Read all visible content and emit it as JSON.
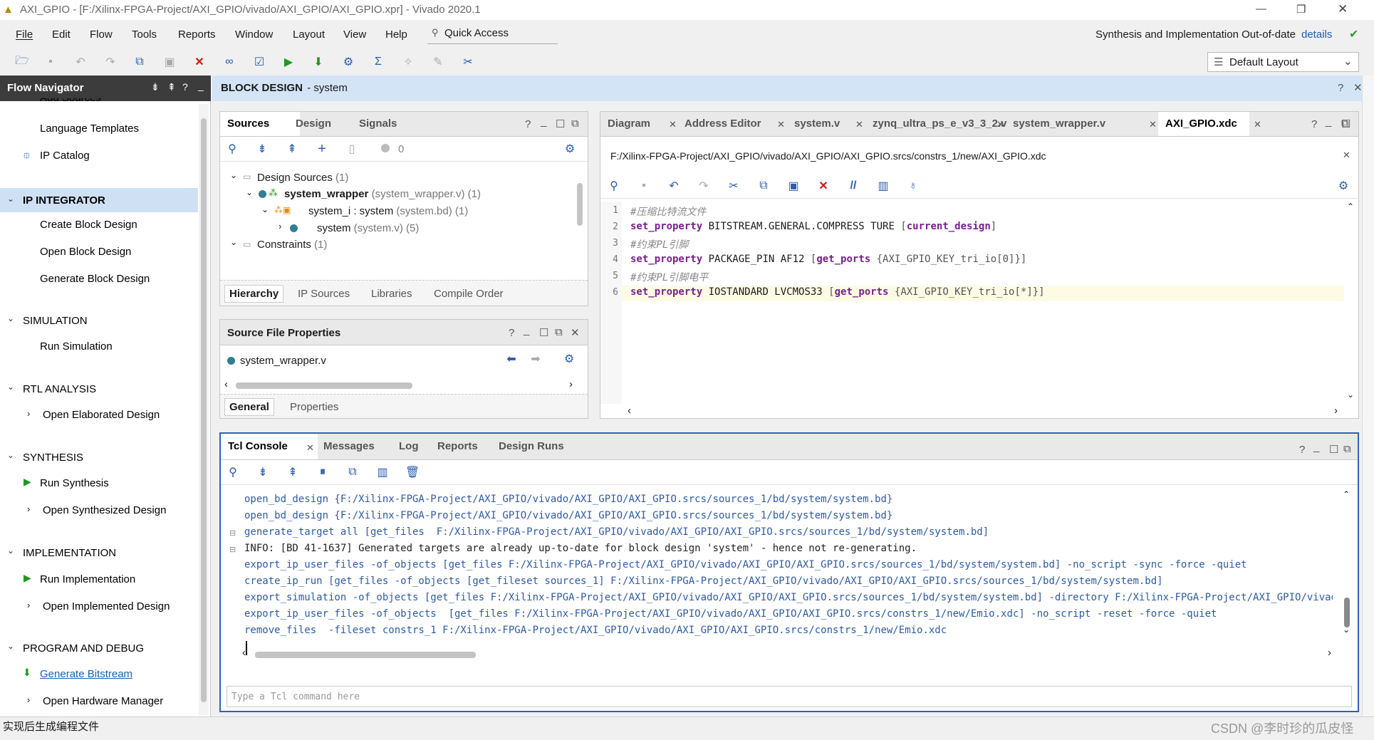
{
  "window": {
    "title": "AXI_GPIO - [F:/Xilinx-FPGA-Project/AXI_GPIO/vivado/AXI_GPIO/AXI_GPIO.xpr] - Vivado 2020.1",
    "controls": [
      "—",
      "❐",
      "✕"
    ]
  },
  "menu": {
    "items": [
      "File",
      "Edit",
      "Flow",
      "Tools",
      "Reports",
      "Window",
      "Layout",
      "View",
      "Help"
    ],
    "quick_access": "Quick Access",
    "status_text": "Synthesis and Implementation Out-of-date",
    "status_link": "details"
  },
  "toolbar": {
    "layout_select": "Default Layout"
  },
  "flow_navigator": {
    "title": "Flow Navigator",
    "partial_top": "Add Sources",
    "language_templates": "Language Templates",
    "ip_catalog": "IP Catalog",
    "sections": [
      {
        "label": "IP INTEGRATOR",
        "items": [
          "Create Block Design",
          "Open Block Design",
          "Generate Block Design"
        ]
      },
      {
        "label": "SIMULATION",
        "items": [
          "Run Simulation"
        ]
      },
      {
        "label": "RTL ANALYSIS",
        "items": [
          "Open Elaborated Design"
        ]
      },
      {
        "label": "SYNTHESIS",
        "items": [
          "Run Synthesis",
          "Open Synthesized Design"
        ]
      },
      {
        "label": "IMPLEMENTATION",
        "items": [
          "Run Implementation",
          "Open Implemented Design"
        ]
      },
      {
        "label": "PROGRAM AND DEBUG",
        "items": [
          "Generate Bitstream",
          "Open Hardware Manager"
        ]
      }
    ]
  },
  "block_design": {
    "title_bold": "BLOCK DESIGN",
    "title_rest": " - system"
  },
  "sources": {
    "tabs": [
      "Sources",
      "Design",
      "Signals"
    ],
    "count_badge": "0",
    "tree": [
      {
        "label": "Design Sources",
        "suffix": " (1)"
      },
      {
        "label": "system_wrapper",
        "suffix": " (system_wrapper.v) (1)"
      },
      {
        "label": "system_i : system",
        "suffix": " (system.bd) (1)"
      },
      {
        "label": "system",
        "suffix": " (system.v) (5)"
      },
      {
        "label": "Constraints",
        "suffix": " (1)"
      }
    ],
    "bottom_tabs": [
      "Hierarchy",
      "IP Sources",
      "Libraries",
      "Compile Order"
    ]
  },
  "source_props": {
    "title": "Source File Properties",
    "file": "system_wrapper.v",
    "tabs": [
      "General",
      "Properties"
    ]
  },
  "editor": {
    "tabs": [
      "Diagram",
      "Address Editor",
      "system.v",
      "zynq_ultra_ps_e_v3_3_2.v",
      "system_wrapper.v",
      "AXI_GPIO.xdc"
    ],
    "path": "F:/Xilinx-FPGA-Project/AXI_GPIO/vivado/AXI_GPIO/AXI_GPIO.srcs/constrs_1/new/AXI_GPIO.xdc",
    "lines": [
      {
        "n": "1",
        "comment": "#压缩比特流文件"
      },
      {
        "n": "2",
        "kw": "set_property",
        "mid": " BITSTREAM.GENERAL.COMPRESS TURE ",
        "bracket": "[",
        "kw2": "current_design",
        "end": "]"
      },
      {
        "n": "3",
        "comment": "#约束PL引脚"
      },
      {
        "n": "4",
        "kw": "set_property",
        "mid": " PACKAGE_PIN AF12 ",
        "bracket": "[",
        "kw2": "get_ports",
        "end": " {AXI_GPIO_KEY_tri_io[0]}]"
      },
      {
        "n": "5",
        "comment": "#约束PL引脚电平"
      },
      {
        "n": "6",
        "kw": "set_property",
        "mid": " IOSTANDARD LVCMOS33 ",
        "bracket": "[",
        "kw2": "get_ports",
        "end": " {AXI_GPIO_KEY_tri_io[*]}]"
      }
    ]
  },
  "console": {
    "tabs": [
      "Tcl Console",
      "Messages",
      "Log",
      "Reports",
      "Design Runs"
    ],
    "lines": [
      "open_bd_design {F:/Xilinx-FPGA-Project/AXI_GPIO/vivado/AXI_GPIO/AXI_GPIO.srcs/sources_1/bd/system/system.bd}",
      "open_bd_design {F:/Xilinx-FPGA-Project/AXI_GPIO/vivado/AXI_GPIO/AXI_GPIO.srcs/sources_1/bd/system/system.bd}",
      "generate_target all [get_files  F:/Xilinx-FPGA-Project/AXI_GPIO/vivado/AXI_GPIO/AXI_GPIO.srcs/sources_1/bd/system/system.bd]",
      "INFO: [BD 41-1637] Generated targets are already up-to-date for block design 'system' - hence not re-generating.",
      "export_ip_user_files -of_objects [get_files F:/Xilinx-FPGA-Project/AXI_GPIO/vivado/AXI_GPIO/AXI_GPIO.srcs/sources_1/bd/system/system.bd] -no_script -sync -force -quiet",
      "create_ip_run [get_files -of_objects [get_fileset sources_1] F:/Xilinx-FPGA-Project/AXI_GPIO/vivado/AXI_GPIO/AXI_GPIO.srcs/sources_1/bd/system/system.bd]",
      "export_simulation -of_objects [get_files F:/Xilinx-FPGA-Project/AXI_GPIO/vivado/AXI_GPIO/AXI_GPIO.srcs/sources_1/bd/system/system.bd] -directory F:/Xilinx-FPGA-Project/AXI_GPIO/vivado/AXI_GPIO",
      "export_ip_user_files -of_objects  [get_files F:/Xilinx-FPGA-Project/AXI_GPIO/vivado/AXI_GPIO/AXI_GPIO.srcs/constrs_1/new/Emio.xdc] -no_script -reset -force -quiet",
      "remove_files  -fileset constrs_1 F:/Xilinx-FPGA-Project/AXI_GPIO/vivado/AXI_GPIO/AXI_GPIO.srcs/constrs_1/new/Emio.xdc"
    ],
    "input_placeholder": "Type a Tcl command here"
  },
  "statusbar": {
    "left": "实现后生成编程文件",
    "watermark": "CSDN @李时珍的瓜皮怪"
  },
  "colors": {
    "accent": "#2b62b9",
    "selected_section": "#cfe0f5",
    "header_bar": "#d4e4f7",
    "keyword": "#7a1f8f",
    "comment": "#888888",
    "run_green": "#1f9a1f",
    "stop_red": "#d01818"
  }
}
